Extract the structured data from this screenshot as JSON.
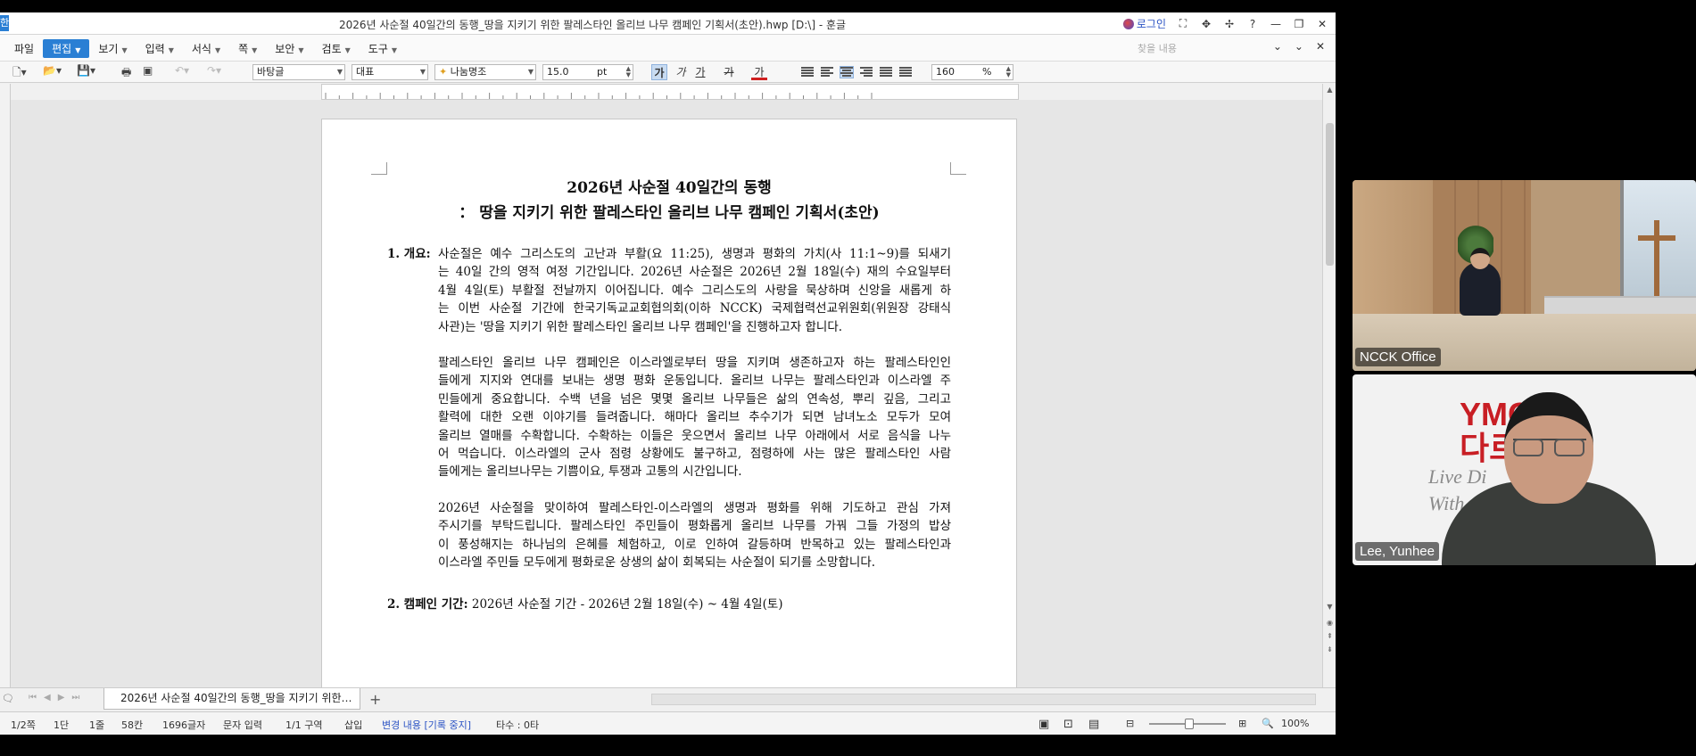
{
  "window": {
    "title": "2026년 사순절 40일간의 동행_땅을 지키기 위한 팔레스타인 올리브 나무 캠페인 기획서(초안).hwp [D:\\] - 훈글",
    "app_icon": "한",
    "login_label": "로그인"
  },
  "menu": {
    "items": [
      {
        "label": "파일",
        "caret": false
      },
      {
        "label": "편집",
        "caret": true,
        "active": true
      },
      {
        "label": "보기",
        "caret": true
      },
      {
        "label": "입력",
        "caret": true
      },
      {
        "label": "서식",
        "caret": true
      },
      {
        "label": "쪽",
        "caret": true
      },
      {
        "label": "보안",
        "caret": true
      },
      {
        "label": "검토",
        "caret": true
      },
      {
        "label": "도구",
        "caret": true
      }
    ],
    "search_placeholder": "찾을 내용"
  },
  "toolbar": {
    "style": "바탕글",
    "language": "대표",
    "font": "나눔명조",
    "size": "15.0",
    "size_unit": "pt",
    "bold": "가",
    "italic": "가",
    "underline": "가",
    "strike": "가",
    "color": "가",
    "zoom": "160",
    "zoom_unit": "%"
  },
  "document": {
    "title1": "2026년 사순절 40일간의 동행",
    "title2": "： 땅을 지키기 위한 팔레스타인 올리브 나무 캠페인 기획서(초안)",
    "section1_head": "1. 개요:",
    "p1": [
      "사순절은 예수 그리스도의 고난과 부활(요 11:25), 생명과 평화의 가치(사 11:1~9)를 되새기",
      "는 40일 간의 영적 여정 기간입니다. 2026년 사순절은 2026년 2월 18일(수) 재의 수요일부터",
      "4월 4일(토) 부활절 전날까지 이어집니다. 예수 그리스도의 사랑을 묵상하며 신앙을 새롭게 하",
      "는 이번 사순절 기간에 한국기독교교회협의회(이하 NCCK) 국제협력선교위원회(위원장 강태식",
      "사관)는 '땅을 지키기 위한 팔레스타인 올리브 나무 캠페인'을 진행하고자 합니다."
    ],
    "p2": [
      "팔레스타인 올리브 나무 캠페인은 이스라엘로부터 땅을 지키며 생존하고자 하는 팔레스타인인",
      "들에게 지지와 연대를 보내는 생명 평화 운동입니다. 올리브 나무는 팔레스타인과 이스라엘 주",
      "민들에게 중요합니다. 수백 년을 넘은 몇몇 올리브 나무들은 삶의 연속성, 뿌리 깊음, 그리고",
      "활력에 대한 오랜 이야기를 들려줍니다. 해마다 올리브 추수기가 되면 남녀노소 모두가 모여",
      "올리브 열매를 수확합니다. 수확하는 이들은 웃으면서 올리브 나무 아래에서 서로 음식을 나누",
      "어 먹습니다. 이스라엘의 군사 점령 상황에도 불구하고, 점령하에 사는 많은 팔레스타인 사람",
      "들에게는 올리브나무는 기쁨이요, 투쟁과 고통의 시간입니다."
    ],
    "p3": [
      "2026년 사순절을 맞이하여 팔레스타인-이스라엘의 생명과 평화를 위해 기도하고 관심 가져",
      "주시기를 부탁드립니다. 팔레스타인 주민들이 평화롭게 올리브 나무를 가꿔 그들 가정의 밥상",
      "이 풍성해지는 하나님의 은혜를 체험하고, 이로 인하여 갈등하며 반목하고 있는 팔레스타인과",
      "이스라엘 주민들 모두에게 평화로운 상생의 삶이 회복되는 사순절이 되기를 소망합니다."
    ],
    "section2_head": "2. 캠페인 기간:",
    "section2_text": "2026년 사순절 기간 - 2026년 2월 18일(수) ~ 4월 4일(토)"
  },
  "tabs": {
    "doc_tab_label": "2026년 사순절 40일간의 동행_땅을 지키기 위한…",
    "add_label": "+"
  },
  "status": {
    "page": "1/2쪽",
    "column": "1단",
    "line": "1줄",
    "col_pos": "58칸",
    "chars": "1696글자",
    "mode": "문자 입력",
    "section": "1/1 구역",
    "insert": "삽입",
    "track": "변경 내용 [기록 중지]",
    "typing": "타수 : 0타",
    "zoom": "100%"
  },
  "video": {
    "tile1_name": "NCCK Office",
    "tile2_name": "Lee, Yunhee",
    "ymca_line1": "YMC",
    "ymca_line2": "다르",
    "live_line1": "Live Di",
    "live_line2": "With"
  }
}
